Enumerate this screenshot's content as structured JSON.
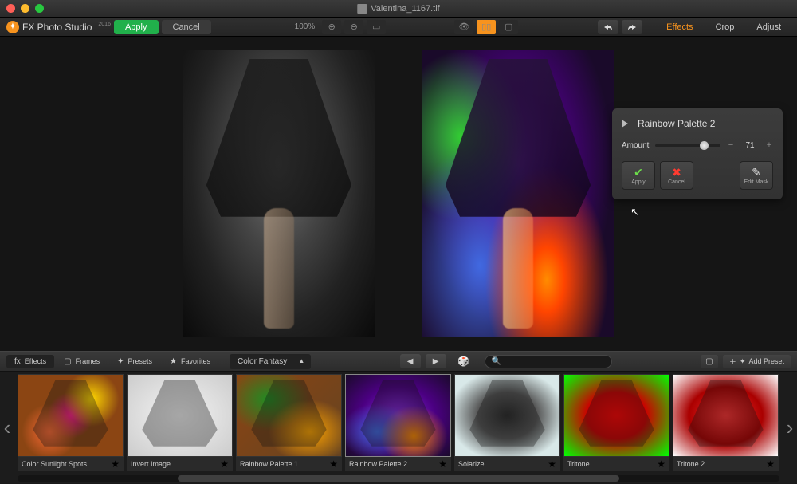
{
  "titlebar": {
    "filename": "Valentina_1167.tif"
  },
  "app": {
    "name": "FX Photo Studio",
    "year": "2016"
  },
  "toolbar": {
    "apply": "Apply",
    "cancel": "Cancel",
    "zoom": "100%",
    "tabs": {
      "effects": "Effects",
      "crop": "Crop",
      "adjust": "Adjust"
    }
  },
  "effect_panel": {
    "title": "Rainbow Palette 2",
    "amount_label": "Amount",
    "amount_value": "71",
    "slider_percent": 71,
    "apply": "Apply",
    "cancel": "Cancel",
    "edit_mask": "Edit Mask"
  },
  "strip": {
    "tabs": {
      "effects": "Effects",
      "frames": "Frames",
      "presets": "Presets",
      "favorites": "Favorites"
    },
    "category": "Color Fantasy",
    "add_preset": "Add Preset",
    "search_placeholder": ""
  },
  "thumbs": [
    {
      "label": "Color Sunlight Spots",
      "class": "t-sunlight",
      "selected": false
    },
    {
      "label": "Invert Image",
      "class": "t-invert",
      "selected": false
    },
    {
      "label": "Rainbow Palette 1",
      "class": "t-rainbow1",
      "selected": false
    },
    {
      "label": "Rainbow Palette 2",
      "class": "t-rainbow2",
      "selected": true
    },
    {
      "label": "Solarize",
      "class": "t-solarize",
      "selected": false
    },
    {
      "label": "Tritone",
      "class": "t-tritone",
      "selected": false
    },
    {
      "label": "Tritone 2",
      "class": "t-tritone2",
      "selected": false
    }
  ]
}
